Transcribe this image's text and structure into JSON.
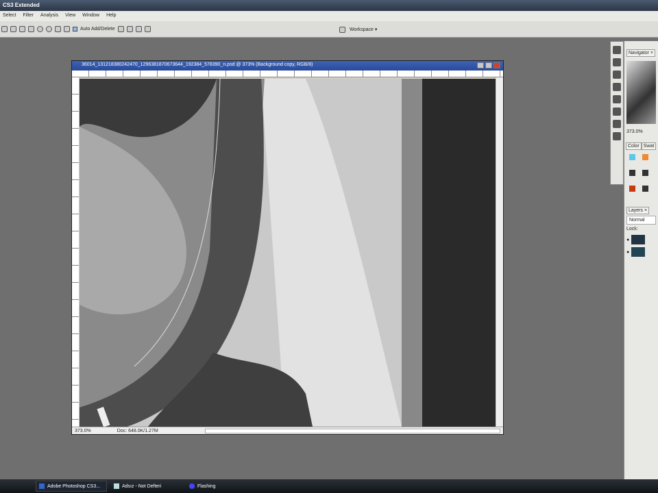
{
  "app": {
    "title": "CS3 Extended"
  },
  "menu": [
    "Select",
    "Filter",
    "Analysis",
    "View",
    "Window",
    "Help"
  ],
  "options": {
    "auto_add_delete": "Auto Add/Delete",
    "workspace": "Workspace ▾"
  },
  "document": {
    "title": "36014_131218380242470_1296381870673644_192384_578390_n.psd @ 373% (Background copy, RGB/8)",
    "zoom": "373.0%",
    "doc_size": "Doc: 648.0K/1.27M"
  },
  "panels": {
    "navigator_tab": "Navigator ×",
    "nav_zoom": "373.0%",
    "color_tab": "Color",
    "swatches_tab": "Swat",
    "layers_tab": "Layers ×",
    "blend_mode": "Normal",
    "lock_label": "Lock:"
  },
  "swatch_colors": [
    "#5bc8e8",
    "#f08a30",
    "#333333",
    "#333333",
    "#c83a10",
    "#333333"
  ],
  "taskbar": [
    {
      "label": "Adobe Photoshop CS3...",
      "active": true
    },
    {
      "label": "Adsız - Not Defteri",
      "active": false
    },
    {
      "label": "Flashing",
      "active": false
    }
  ]
}
